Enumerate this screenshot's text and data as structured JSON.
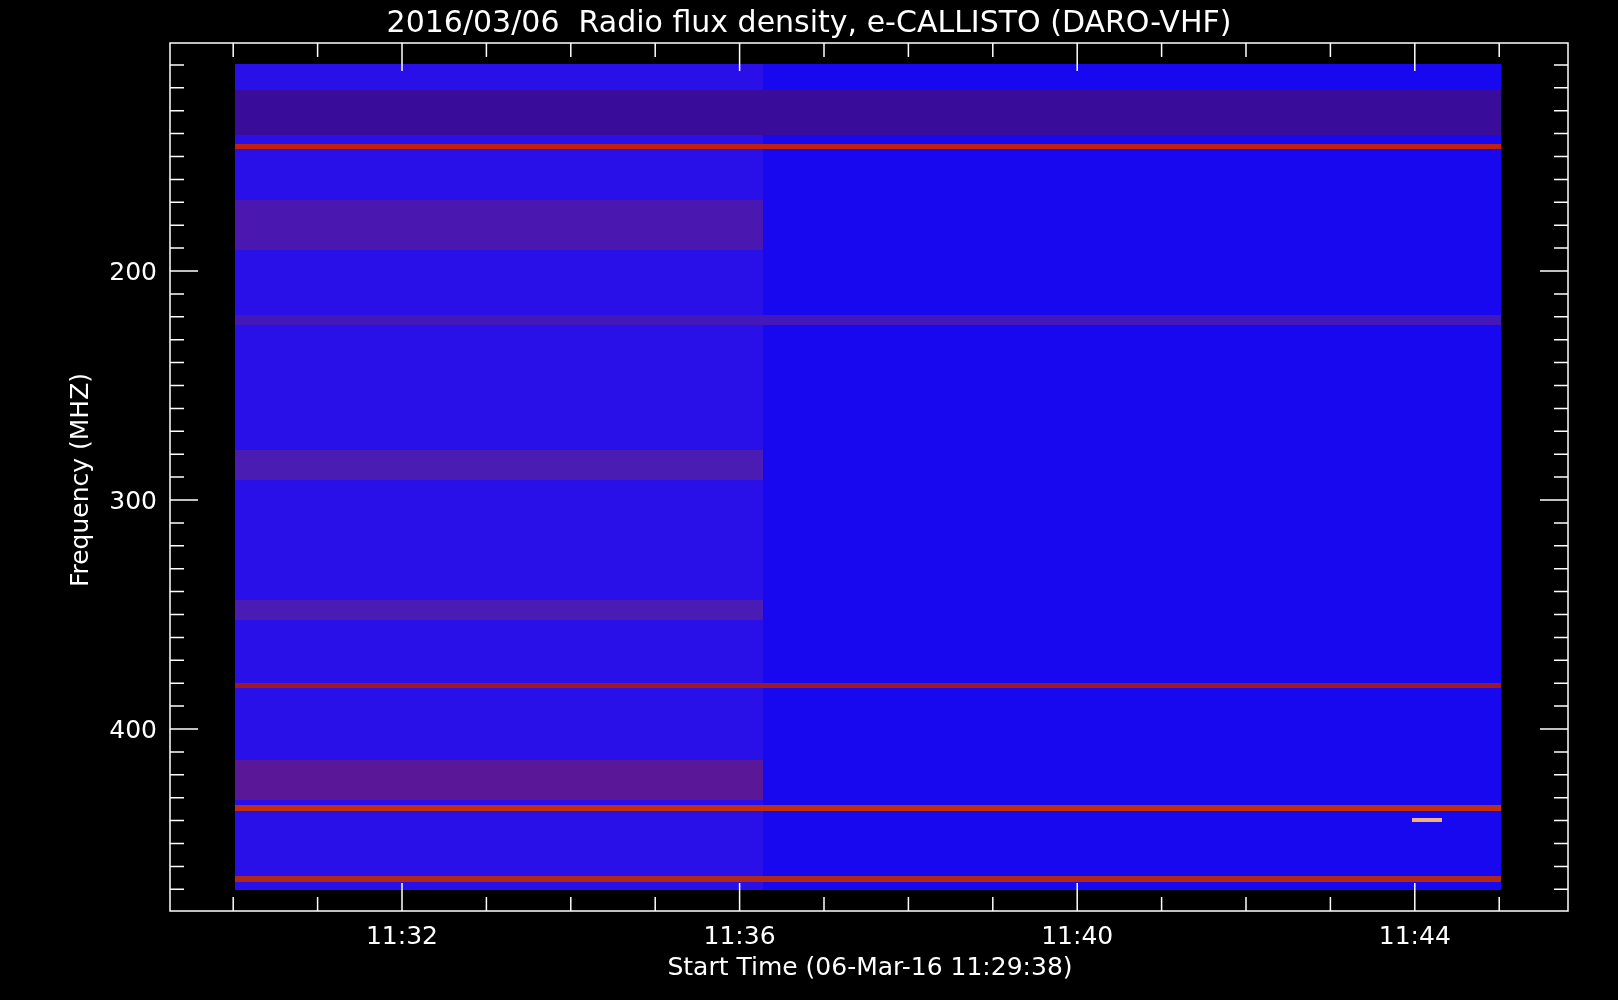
{
  "title": "2016/03/06  Radio flux density, e-CALLISTO (DARO-VHF)",
  "ylabel": "Frequency (MHZ)",
  "xlabel": "Start Time (06-Mar-16 11:29:38)",
  "yticks": [
    "200",
    "300",
    "400"
  ],
  "xticks": [
    "11:32",
    "11:36",
    "11:40",
    "11:44"
  ]
}
